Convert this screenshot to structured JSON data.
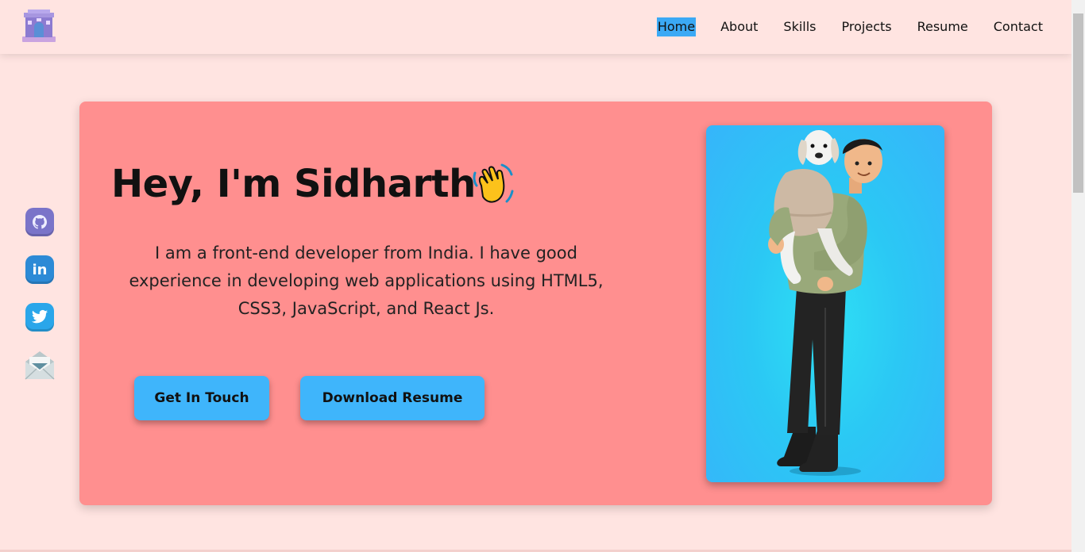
{
  "header": {
    "nav": [
      {
        "label": "Home",
        "active": true
      },
      {
        "label": "About",
        "active": false
      },
      {
        "label": "Skills",
        "active": false
      },
      {
        "label": "Projects",
        "active": false
      },
      {
        "label": "Resume",
        "active": false
      },
      {
        "label": "Contact",
        "active": false
      }
    ],
    "logo_icon": "india-gate-icon"
  },
  "social": [
    {
      "name": "github",
      "icon": "github-icon",
      "color": "#7a74c9"
    },
    {
      "name": "linkedin",
      "icon": "linkedin-icon",
      "color": "#2c8ad6"
    },
    {
      "name": "twitter",
      "icon": "twitter-icon",
      "color": "#2aa6ea"
    },
    {
      "name": "email",
      "icon": "envelope-icon",
      "color": "#cfd8da"
    }
  ],
  "hero": {
    "greeting": "Hey, I'm Sidharth",
    "wave_icon": "waving-hand-icon",
    "intro": "I am a front-end developer from India. I have good experience in developing web applications using HTML5, CSS3, JavaScript, and React Js.",
    "primary_button": "Get In Touch",
    "secondary_button": "Download Resume"
  },
  "colors": {
    "page_bg": "#ffe4e1",
    "hero_bg": "#ff8f8f",
    "accent": "#3fb5fb",
    "portrait_bg": "#2bc8f4"
  }
}
